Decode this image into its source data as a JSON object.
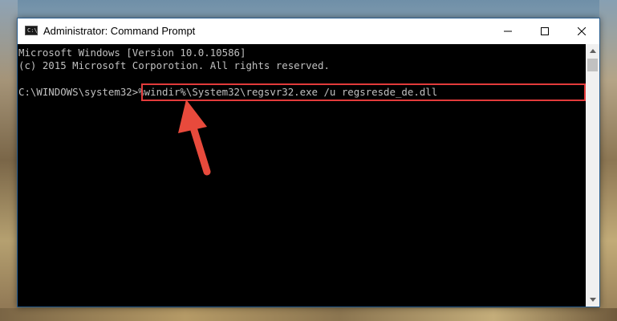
{
  "window": {
    "title": "Administrator: Command Prompt",
    "icon_label": "C:\\",
    "controls": {
      "minimize": "minimize-icon",
      "maximize": "maximize-icon",
      "close": "close-icon"
    }
  },
  "console": {
    "line1": "Microsoft Windows [Version 10.0.10586]",
    "line2": "(c) 2015 Microsoft Corporotion. All rights reserved.",
    "prompt": "C:\\WINDOWS\\system32>",
    "command": "%windir%\\System32\\regsvr32.exe /u regsresde_de.dll"
  },
  "annotation": {
    "highlight_color": "#e23b3b",
    "arrow_color": "#e84a3c"
  }
}
